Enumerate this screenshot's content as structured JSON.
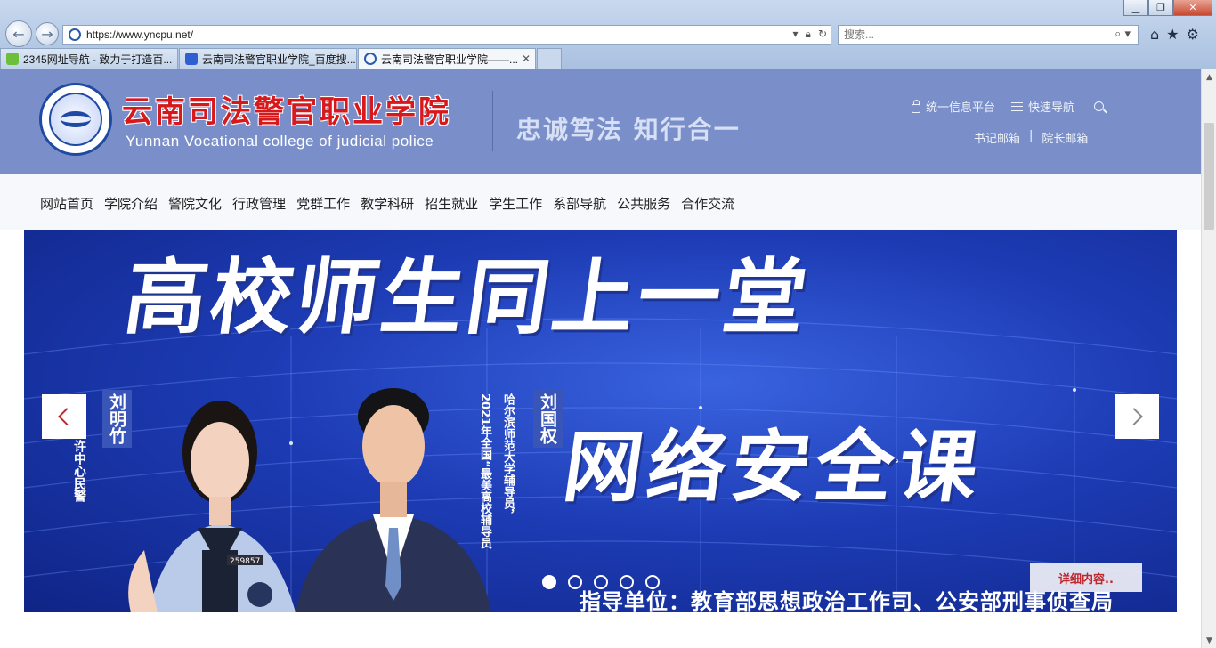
{
  "browser": {
    "url": "https://www.yncpu.net/",
    "search_placeholder": "搜索...",
    "tabs": [
      {
        "label": "2345网址导航 - 致力于打造百..."
      },
      {
        "label": "云南司法警官职业学院_百度搜..."
      },
      {
        "label": "云南司法警官职业学院——..."
      }
    ],
    "colors": {
      "accent": "#7a8fc9",
      "brand_red": "#d8191c"
    }
  },
  "header": {
    "name_cn": "云南司法警官职业学院",
    "name_en": "Yunnan Vocational college of judicial police",
    "motto": "忠诚笃法  知行合一",
    "links": {
      "platform": "统一信息平台",
      "quicknav": "快速导航",
      "secretary_mail": "书记邮箱",
      "separator": "|",
      "president_mail": "院长邮箱"
    }
  },
  "nav": {
    "items": [
      "网站首页",
      "学院介绍",
      "警院文化",
      "行政管理",
      "党群工作",
      "教学科研",
      "招生就业",
      "学生工作",
      "系部导航",
      "公共服务",
      "合作交流"
    ]
  },
  "banner": {
    "headline_top": "高校师生同上一堂",
    "headline_bottom": "网络安全课",
    "guide_line": "指导单位：教育部思想政治工作司、公安部刑事侦查局",
    "person_left_name": "刘明竹",
    "person_left_desc": "许中心民警",
    "person_right_name": "刘国权",
    "person_right_desc_1": "哈尔滨师范大学辅导员，",
    "person_right_desc_2": "2021年全国“最美高校辅导员",
    "badge_number": "259857",
    "details_label": "详细内容..",
    "slide_count": 5,
    "active_slide": 1
  }
}
